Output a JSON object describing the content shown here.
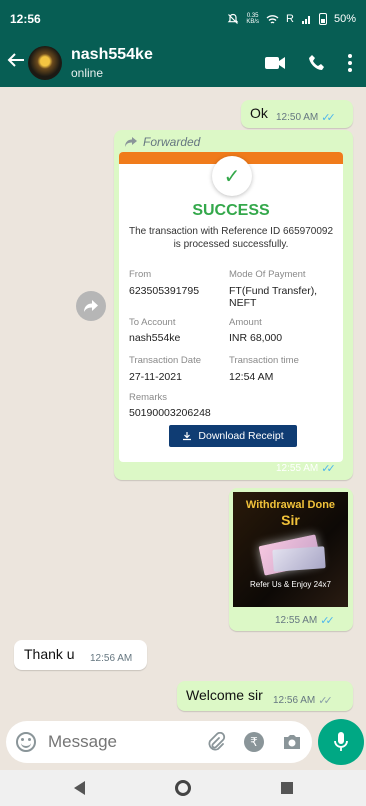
{
  "status": {
    "time": "12:56",
    "net": "0.35\nKB/s",
    "carrier": "R",
    "battery": "50%"
  },
  "header": {
    "back_icon": "arrow-left-icon",
    "contact_name": "nash554ke",
    "contact_status": "online"
  },
  "messages": {
    "ok": {
      "text": "Ok",
      "time": "12:50 AM"
    },
    "forwarded": {
      "label": "Forwarded",
      "time": "12:55 AM",
      "receipt": {
        "status": "SUCCESS",
        "description": "The transaction with Reference ID 665970092 is processed successfully.",
        "from_label": "From",
        "from_value": "623505391795",
        "mode_label": "Mode Of Payment",
        "mode_value": "FT(Fund Transfer), NEFT",
        "to_label": "To Account",
        "to_value": "nash554ke",
        "amount_label": "Amount",
        "amount_value": "INR 68,000",
        "date_label": "Transaction Date",
        "date_value": "27-11-2021",
        "ttime_label": "Transaction time",
        "ttime_value": "12:54 AM",
        "remarks_label": "Remarks",
        "remarks_value": "50190003206248",
        "download_label": "Download Receipt"
      }
    },
    "image": {
      "title": "Withdrawal Done",
      "subtitle": "Sir",
      "footer": "Refer Us & Enjoy 24x7",
      "time": "12:55 AM"
    },
    "thanku": {
      "text": "Thank u",
      "time": "12:56 AM"
    },
    "welcome": {
      "text": "Welcome sir",
      "time": "12:56 AM"
    }
  },
  "composer": {
    "placeholder": "Message"
  }
}
